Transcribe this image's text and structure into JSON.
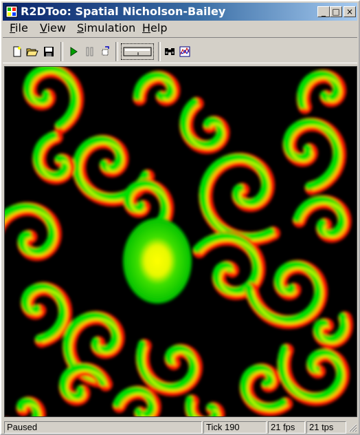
{
  "window": {
    "title": "R2DToo: Spatial Nicholson-Bailey"
  },
  "menu": [
    {
      "first": "F",
      "rest": "ile"
    },
    {
      "first": "V",
      "rest": "iew"
    },
    {
      "first": "S",
      "rest": "imulation"
    },
    {
      "first": "H",
      "rest": "elp"
    }
  ],
  "title_buttons": {
    "minimize": "_",
    "maximize": "□",
    "close": "×"
  },
  "toolbar": {
    "buttons": [
      "new-file-icon",
      "open-folder-icon",
      "save-disk-icon",
      "play-icon",
      "pause-icon",
      "step-icon",
      "speed-control",
      "binoculars-icon",
      "graph-icon"
    ]
  },
  "simulation": {
    "colors": {
      "prey": "#00e000",
      "predator": "#ff1a00",
      "overlap": "#ffff00",
      "empty": "#000000"
    }
  },
  "status": {
    "state": "Paused",
    "tick": "Tick 190",
    "fps": "21 fps",
    "tps": "21 tps"
  }
}
